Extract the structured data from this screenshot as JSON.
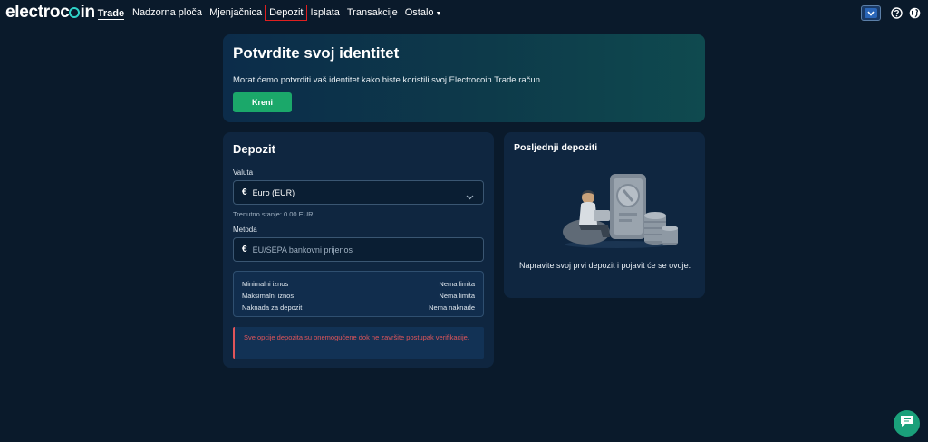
{
  "brand": {
    "name_part1": "electroc",
    "name_part2": "in",
    "sub": "Trade"
  },
  "nav": {
    "items": [
      {
        "label": "Nadzorna ploča",
        "active": false
      },
      {
        "label": "Mjenjačnica",
        "active": false
      },
      {
        "label": "Depozit",
        "active": true
      },
      {
        "label": "Isplata",
        "active": false
      },
      {
        "label": "Transakcije",
        "active": false
      },
      {
        "label": "Ostalo",
        "active": false
      }
    ],
    "right_icons": [
      "chevron-down-icon",
      "help-icon",
      "globe-icon"
    ]
  },
  "banner": {
    "title": "Potvrdite svoj identitet",
    "text": "Morat ćemo potvrditi vaš identitet kako biste koristili svoj Electrocoin Trade račun.",
    "button": "Kreni"
  },
  "deposit": {
    "title": "Depozit",
    "currency_label": "Valuta",
    "currency_symbol": "€",
    "currency_value": "Euro (EUR)",
    "balance_note": "Trenutno stanje: 0.00 EUR",
    "method_label": "Metoda",
    "method_symbol": "€",
    "method_value": "EU/SEPA bankovni prijenos",
    "limits": [
      {
        "label": "Minimalni iznos",
        "value": "Nema limita"
      },
      {
        "label": "Maksimalni iznos",
        "value": "Nema limita"
      },
      {
        "label": "Naknada za depozit",
        "value": "Nema naknade"
      }
    ],
    "warning": "Sve opcije depozita su onemogućene dok ne završite postupak verifikacije."
  },
  "recent": {
    "title": "Posljednji depoziti",
    "empty_text": "Napravite svoj prvi depozit i pojavit će se ovdje."
  },
  "colors": {
    "background": "#0a1a2b",
    "panel": "#0f2640",
    "accent_green": "#1ba86a",
    "warning_red": "#e0555a",
    "active_nav_outline": "#e02020",
    "logo_ring": "#2fd3c8"
  }
}
